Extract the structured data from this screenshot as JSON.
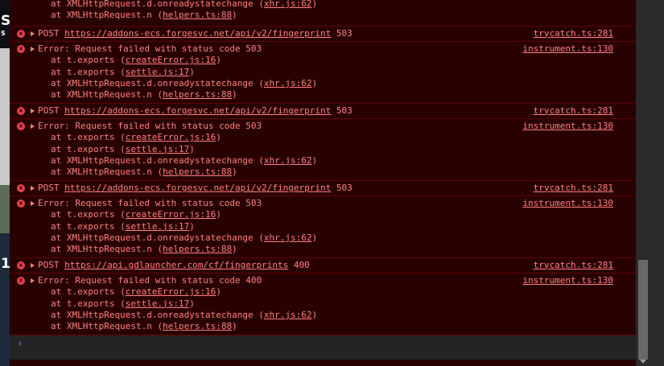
{
  "background": {
    "left_text_top": "S:",
    "left_text_small": "S",
    "left_text_bottom": "1"
  },
  "entries": [
    {
      "kind": "stack_tail",
      "stack": [
        {
          "prefix": "at XMLHttpRequest.d.onreadystatechange (",
          "link": "xhr.js:62",
          "suffix": ")"
        },
        {
          "prefix": "at XMLHttpRequest.n (",
          "link": "helpers.ts:88",
          "suffix": ")"
        }
      ]
    },
    {
      "kind": "network",
      "method": "POST",
      "url": "https://addons-ecs.forgesvc.net/api/v2/fingerprint",
      "status": "503",
      "source": "trycatch.ts:281"
    },
    {
      "kind": "error",
      "message": "Error: Request failed with status code 503",
      "source": "instrument.ts:130",
      "stack": [
        {
          "prefix": "at t.exports (",
          "link": "createError.js:16",
          "suffix": ")"
        },
        {
          "prefix": "at t.exports (",
          "link": "settle.js:17",
          "suffix": ")"
        },
        {
          "prefix": "at XMLHttpRequest.d.onreadystatechange (",
          "link": "xhr.js:62",
          "suffix": ")"
        },
        {
          "prefix": "at XMLHttpRequest.n (",
          "link": "helpers.ts:88",
          "suffix": ")"
        }
      ]
    },
    {
      "kind": "network",
      "method": "POST",
      "url": "https://addons-ecs.forgesvc.net/api/v2/fingerprint",
      "status": "503",
      "source": "trycatch.ts:281"
    },
    {
      "kind": "error",
      "message": "Error: Request failed with status code 503",
      "source": "instrument.ts:130",
      "stack": [
        {
          "prefix": "at t.exports (",
          "link": "createError.js:16",
          "suffix": ")"
        },
        {
          "prefix": "at t.exports (",
          "link": "settle.js:17",
          "suffix": ")"
        },
        {
          "prefix": "at XMLHttpRequest.d.onreadystatechange (",
          "link": "xhr.js:62",
          "suffix": ")"
        },
        {
          "prefix": "at XMLHttpRequest.n (",
          "link": "helpers.ts:88",
          "suffix": ")"
        }
      ]
    },
    {
      "kind": "network",
      "method": "POST",
      "url": "https://addons-ecs.forgesvc.net/api/v2/fingerprint",
      "status": "503",
      "source": "trycatch.ts:281"
    },
    {
      "kind": "error",
      "message": "Error: Request failed with status code 503",
      "source": "instrument.ts:130",
      "stack": [
        {
          "prefix": "at t.exports (",
          "link": "createError.js:16",
          "suffix": ")"
        },
        {
          "prefix": "at t.exports (",
          "link": "settle.js:17",
          "suffix": ")"
        },
        {
          "prefix": "at XMLHttpRequest.d.onreadystatechange (",
          "link": "xhr.js:62",
          "suffix": ")"
        },
        {
          "prefix": "at XMLHttpRequest.n (",
          "link": "helpers.ts:88",
          "suffix": ")"
        }
      ]
    },
    {
      "kind": "network",
      "method": "POST",
      "url": "https://api.gdlauncher.com/cf/fingerprints",
      "status": "400",
      "source": "trycatch.ts:281"
    },
    {
      "kind": "error",
      "message": "Error: Request failed with status code 400",
      "source": "instrument.ts:130",
      "stack": [
        {
          "prefix": "at t.exports (",
          "link": "createError.js:16",
          "suffix": ")"
        },
        {
          "prefix": "at t.exports (",
          "link": "settle.js:17",
          "suffix": ")"
        },
        {
          "prefix": "at XMLHttpRequest.d.onreadystatechange (",
          "link": "xhr.js:62",
          "suffix": ")"
        },
        {
          "prefix": "at XMLHttpRequest.n (",
          "link": "helpers.ts:88",
          "suffix": ")"
        }
      ]
    }
  ],
  "prompt": {
    "symbol": "›"
  },
  "colors": {
    "error_text": "#ff8080",
    "error_bg": "#290000",
    "error_border": "#5c0000",
    "error_icon": "#e6434f",
    "prompt": "#4d90fe"
  }
}
